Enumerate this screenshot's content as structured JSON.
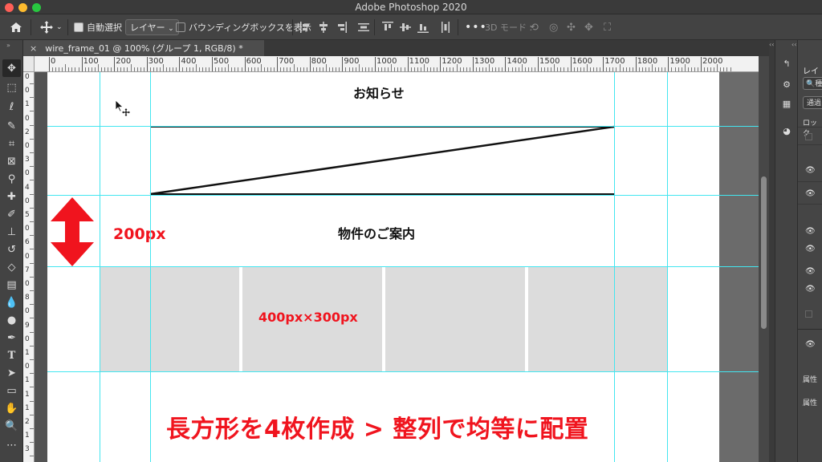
{
  "app": {
    "title": "Adobe Photoshop 2020",
    "traffic_colors": [
      "#fe5f57",
      "#febc2e",
      "#28c840"
    ]
  },
  "options_bar": {
    "auto_select_label": "自動選択 :",
    "auto_select_checked": true,
    "target_value": "レイヤー",
    "show_transform_label": "バウンディングボックスを表示",
    "show_transform_checked": false,
    "mode_3d_label": "3D モード :"
  },
  "document_tab": {
    "title": "wire_frame_01 @ 100% (グループ 1, RGB/8) *",
    "close_label": "×"
  },
  "ruler": {
    "h_labels": [
      "0",
      "100",
      "200",
      "300",
      "400",
      "500",
      "600",
      "700",
      "800",
      "900",
      "1000",
      "1100",
      "1200",
      "1300",
      "1400",
      "1500",
      "1600",
      "1700",
      "1800",
      "1900",
      "2000"
    ],
    "v_labels": [
      "0",
      "0",
      "1",
      "0",
      "2",
      "0",
      "3",
      "0",
      "4",
      "0",
      "5",
      "0",
      "6",
      "0",
      "7",
      "0",
      "8",
      "0",
      "9",
      "0",
      "1",
      "0",
      "1",
      "1",
      "1",
      "2",
      "1",
      "3"
    ]
  },
  "canvas": {
    "notice_heading": "お知らせ",
    "property_heading": "物件のご案内",
    "height_label": "200px",
    "card_size_label": "400px×300px",
    "instruction_text": "長方形を4枚作成 > 整列で均等に配置",
    "guide_color": "#43e6f0",
    "red_color": "#f0141e",
    "card_color": "#dcdcdc"
  },
  "right_panel": {
    "layers_tab": "レイ",
    "search_placeholder": "種",
    "blend_mode": "通過",
    "lock_label": "ロック",
    "properties_label_1": "属性",
    "properties_label_2": "属性"
  }
}
